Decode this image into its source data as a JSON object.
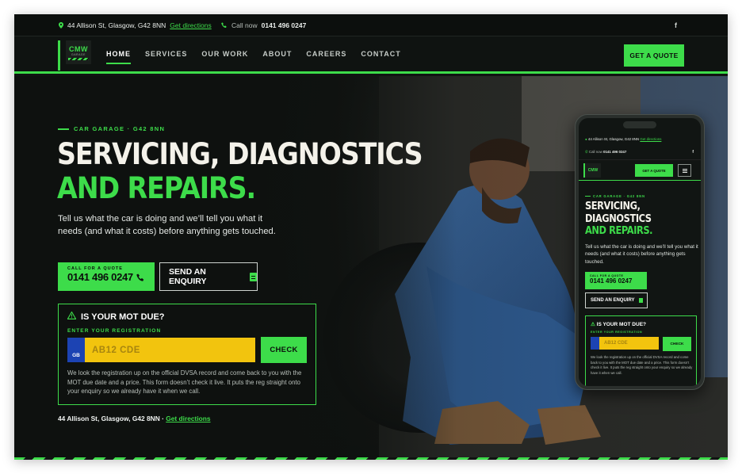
{
  "topbar": {
    "address": "44 Allison St, Glasgow, G42 8NN",
    "directions": "Get directions",
    "call_label": "Call now",
    "phone": "0141 496 0247",
    "social": "f"
  },
  "nav": {
    "logo": "CMW",
    "logo_sub": "GARAGE",
    "items": [
      {
        "label": "HOME"
      },
      {
        "label": "SERVICES"
      },
      {
        "label": "OUR WORK"
      },
      {
        "label": "ABOUT"
      },
      {
        "label": "CAREERS"
      },
      {
        "label": "CONTACT"
      }
    ],
    "cta": "GET A QUOTE"
  },
  "hero": {
    "eyebrow": "CAR GARAGE · G42 8NN",
    "title_line1": "SERVICING, DIAGNOSTICS",
    "title_line2": "AND REPAIRS.",
    "lede": "Tell us what the car is doing and we’ll tell you what it needs (and what it costs) before anything gets touched.",
    "call_small": "CALL FOR A QUOTE",
    "call_number": "0141 496 0247",
    "enquiry": "SEND AN ENQUIRY"
  },
  "mot": {
    "title": "IS YOUR MOT DUE?",
    "label": "ENTER YOUR REGISTRATION",
    "plate_country": "GB",
    "placeholder": "AB12 CDE",
    "check": "CHECK",
    "note": "We look the registration up on the official DVSA record and come back to you with the MOT due date and a price. This form doesn’t check it live. It puts the reg straight onto your enquiry so we already have it when we call."
  },
  "footer_address": {
    "text": "44 Allison St, Glasgow, G42 8NN ·",
    "link": "Get directions"
  },
  "phone_mockup": {
    "address": "44 Allison St, Glasgow, G42 8NN",
    "directions": "Get directions",
    "call_label": "Call now",
    "phone": "0141 496 0247",
    "social": "f",
    "logo": "CMW",
    "cta": "GET A QUOTE",
    "eyebrow": "CAR GARAGE · G42 8NN",
    "title_line1": "SERVICING,",
    "title_line2": "DIAGNOSTICS",
    "title_line3": "AND REPAIRS.",
    "lede": "Tell us what the car is doing and we’ll tell you what it needs (and what it costs) before anything gets touched.",
    "call_small": "CALL FOR A QUOTE",
    "call_number": "0141 496 0247",
    "enquiry": "SEND AN ENQUIRY",
    "mot_title": "IS YOUR MOT DUE?",
    "mot_label": "ENTER YOUR REGISTRATION",
    "placeholder": "AB12 CDE",
    "check": "CHECK",
    "note": "We look the registration up on the official DVSA record and come back to you with the MOT due date and a price. This form doesn’t check it live. It puts the reg straight onto your enquiry so we already have it when we call."
  },
  "colors": {
    "accent": "#3ddc4a",
    "background": "#101412",
    "plate": "#f2c40e",
    "plate_band": "#1c43b3",
    "text": "#f4f2ea"
  },
  "icons": [
    "location-pin-icon",
    "phone-icon",
    "facebook-icon",
    "warning-icon",
    "document-icon",
    "menu-icon"
  ]
}
